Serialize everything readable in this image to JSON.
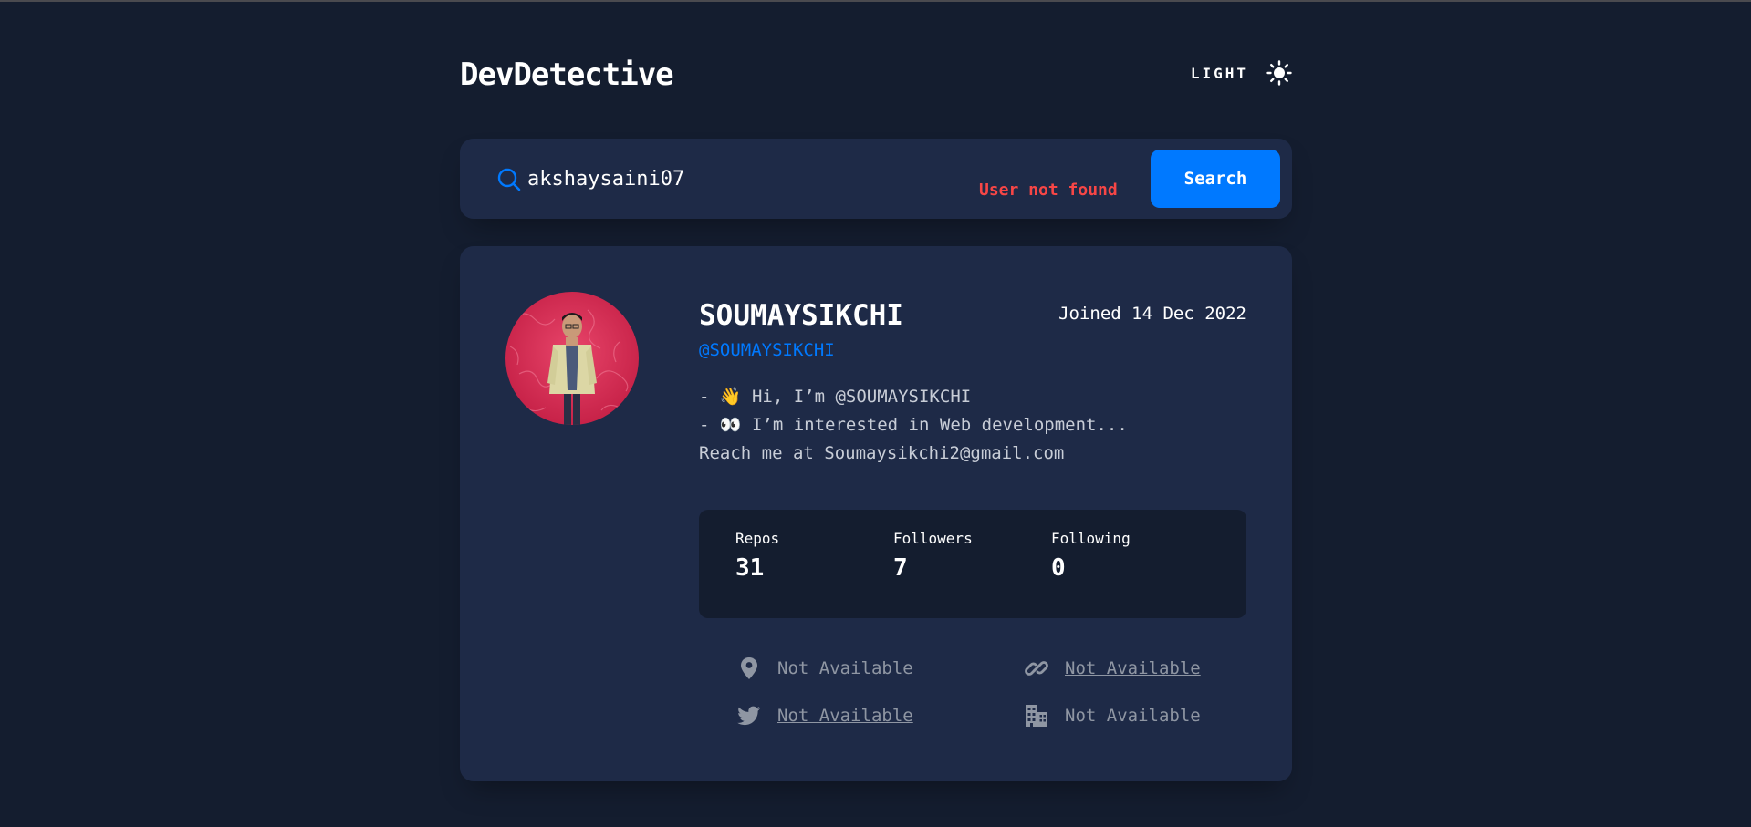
{
  "app": {
    "title": "DevDetective"
  },
  "theme_toggle": {
    "label": "LIGHT",
    "icon": "sun-icon"
  },
  "search": {
    "value": "akshaysaini07",
    "icon": "search-icon",
    "error": "User not found",
    "button_label": "Search"
  },
  "profile": {
    "name": "SOUMAYSIKCHI",
    "joined": "Joined 14 Dec 2022",
    "handle": "@SOUMAYSIKCHI",
    "bio": [
      "- 👋 Hi, I’m @SOUMAYSIKCHI",
      "- 👀 I’m interested in Web development...",
      "Reach me at Soumaysikchi2@gmail.com"
    ],
    "stats": [
      {
        "label": "Repos",
        "value": "31"
      },
      {
        "label": "Followers",
        "value": "7"
      },
      {
        "label": "Following",
        "value": "0"
      }
    ],
    "links": {
      "location": "Not Available",
      "website": "Not Available",
      "twitter": "Not Available",
      "company": "Not Available"
    }
  },
  "colors": {
    "background": "#141d2f",
    "card": "#1e2a47",
    "accent": "#0079ff",
    "error": "#f74646",
    "muted": "#8f96a3"
  }
}
